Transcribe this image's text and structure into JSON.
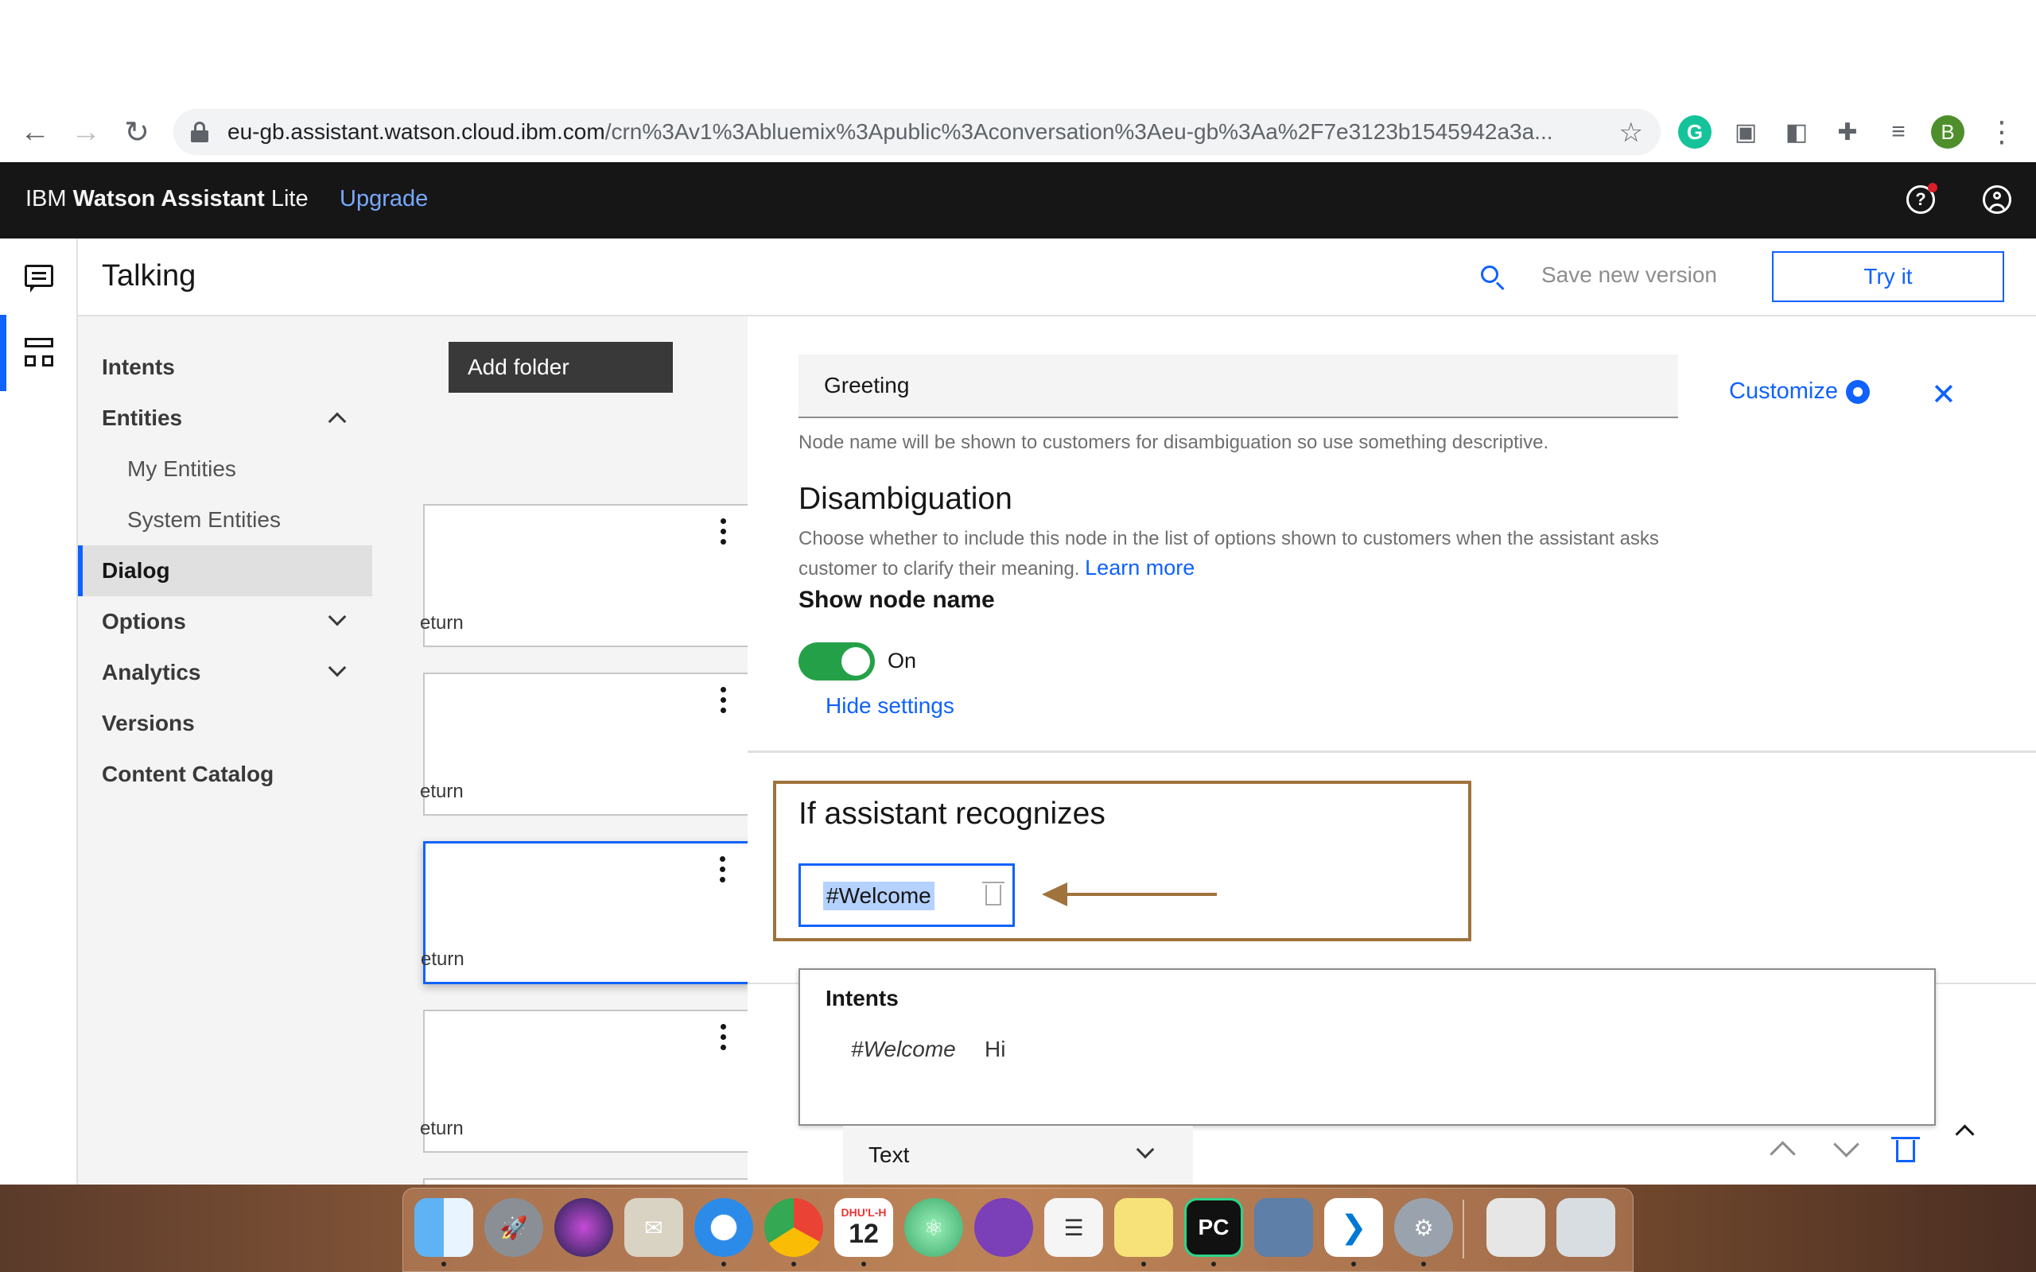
{
  "browser": {
    "url_host": "eu-gb.assistant.watson.cloud.ibm.com",
    "url_path": "/crn%3Av1%3Abluemix%3Apublic%3Aconversation%3Aeu-gb%3Aa%2F7e3123b1545942a3a...",
    "profile_initial": "B",
    "grammarly_label": "G"
  },
  "header": {
    "brand_prefix": "IBM ",
    "brand_bold": "Watson Assistant",
    "brand_suffix": " Lite",
    "upgrade": "Upgrade",
    "help_glyph": "?"
  },
  "page": {
    "title": "Talking",
    "save_version": "Save new version",
    "try_it": "Try it"
  },
  "side_nav": {
    "intents": "Intents",
    "entities": "Entities",
    "my_entities": "My Entities",
    "system_entities": "System Entities",
    "dialog": "Dialog",
    "options": "Options",
    "analytics": "Analytics",
    "versions": "Versions",
    "content_catalog": "Content Catalog"
  },
  "tree": {
    "add_folder": "Add folder",
    "nodes": [
      {
        "footer": "eturn"
      },
      {
        "footer": "eturn"
      },
      {
        "footer": "eturn"
      },
      {
        "footer": "eturn"
      }
    ]
  },
  "editor": {
    "node_name": "Greeting",
    "helper_text": "Node name will be shown to customers for disambiguation so use something descriptive.",
    "customize": "Customize",
    "close_glyph": "✕",
    "disambiguation_title": "Disambiguation",
    "disambiguation_desc": "Choose whether to include this node in the list of options shown to customers when the assistant asks customer to clarify their meaning.",
    "learn_more": "Learn more",
    "show_node_name": "Show node name",
    "toggle_state": "On",
    "hide_settings": "Hide settings",
    "recognizes_title": "If assistant recognizes",
    "condition": "#Welcome",
    "suggest_header": "Intents",
    "suggest_intent": "#Welcome",
    "suggest_example": "Hi",
    "response_type": "Text"
  },
  "colors": {
    "accent": "#0f62fe",
    "header_bg": "#161616",
    "toggle_on": "#24a148",
    "annotation": "#a0733c"
  },
  "dock": {
    "calendar_month": "DHU'L-H",
    "calendar_day": "12",
    "pycharm_label": "PC"
  }
}
